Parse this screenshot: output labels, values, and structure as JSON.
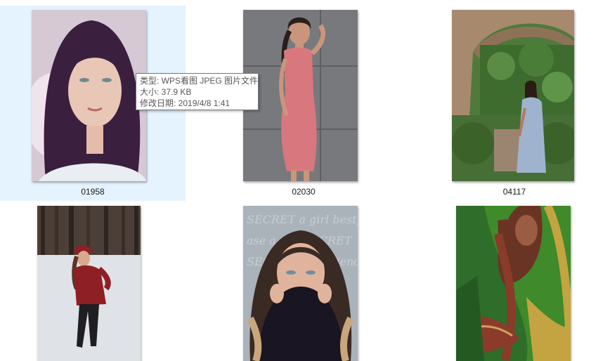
{
  "files": [
    {
      "name": "01958",
      "selected": true,
      "colors": {
        "bg": "#c8b5c5",
        "accent": "#3a1f3f",
        "skin": "#e9c7b6"
      }
    },
    {
      "name": "02030",
      "selected": false,
      "colors": {
        "bg": "#7a7c80",
        "accent": "#d8777e",
        "skin": "#c9967c"
      }
    },
    {
      "name": "04117",
      "selected": false,
      "colors": {
        "bg": "#4f7a3c",
        "accent": "#9fb3cf",
        "skin": "#b27a5f"
      }
    },
    {
      "name": "",
      "selected": false,
      "colors": {
        "bg": "#e7e9ec",
        "accent": "#8e1f24",
        "skin": "#d9a88f"
      }
    },
    {
      "name": "",
      "selected": false,
      "colors": {
        "bg": "#aab2b8",
        "accent": "#191522",
        "skin": "#e0b49c"
      }
    },
    {
      "name": "",
      "selected": false,
      "colors": {
        "bg": "#2f6d2a",
        "accent": "#3f8a2a",
        "skin": "#9a5c42"
      }
    }
  ],
  "tooltip": {
    "type_line": "类型: WPS看图 JPEG 图片文件",
    "size_line": "大小: 37.9 KB",
    "date_line": "修改日期: 2019/4/8 1:41"
  },
  "theme": {
    "selection_bg": "#e5f3ff",
    "tooltip_border": "#767676",
    "caption_color": "#1a1a1a"
  }
}
